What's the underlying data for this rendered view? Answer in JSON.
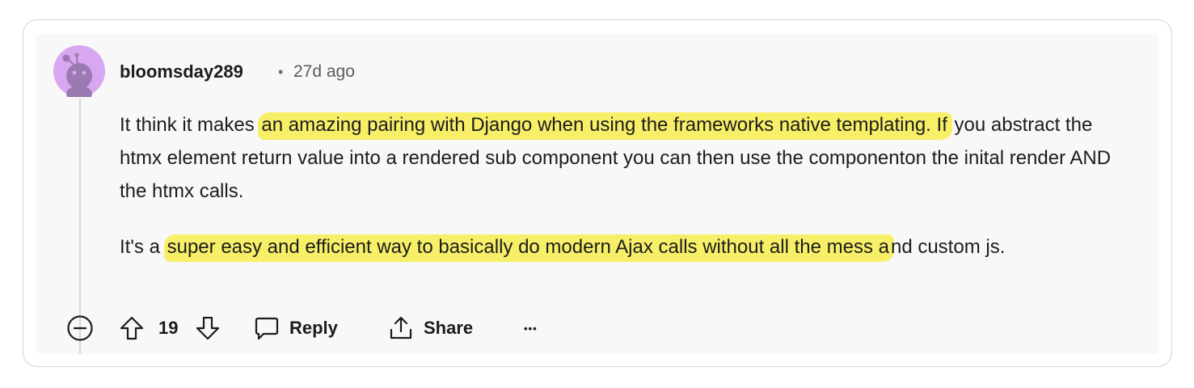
{
  "comment": {
    "username": "bloomsday289",
    "separator": "•",
    "timestamp": "27d ago",
    "paragraph1": {
      "pre": "It think it makes",
      "highlight": "an amazing pairing with Django when using the frameworks native templating. If",
      "post": "you abstract the htmx element return value into a rendered sub component you can then use the componenton the inital render AND the htmx calls."
    },
    "paragraph2": {
      "pre": "It's a",
      "highlight": "super easy and efficient way to basically do modern Ajax calls without all the mess a",
      "post": "nd custom js."
    }
  },
  "actions": {
    "score": "19",
    "reply_label": "Reply",
    "share_label": "Share",
    "more_label": "•••"
  },
  "icons": {
    "collapse": "minus-circle-icon",
    "upvote": "arrow-up-icon",
    "downvote": "arrow-down-icon",
    "reply": "speech-bubble-icon",
    "share": "share-upload-icon",
    "more": "ellipsis-icon"
  },
  "colors": {
    "highlight": "#f7ef67",
    "avatar_bg": "#d9a7f2",
    "avatar_figure": "#9a7ab0",
    "card_border": "#d4d4d4",
    "panel_bg": "#f8f8f8"
  }
}
